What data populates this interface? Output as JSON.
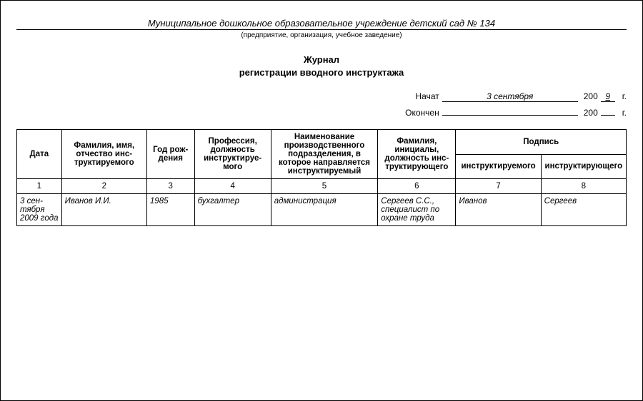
{
  "header": {
    "org_name": "Муниципальное дошкольное образовательное учреждение детский сад № 134",
    "org_sub": "(предприятие, организация, учебное заведение)",
    "title_line1": "Журнал",
    "title_line2": "регистрации вводного инструктажа"
  },
  "dates": {
    "start_label": "Начат",
    "start_value": "3 сентября",
    "century": "200",
    "start_year_digit": "9",
    "end_label": "Окончен",
    "end_value": "",
    "end_year_digit": "",
    "g": "г."
  },
  "columns": {
    "c1": "Дата",
    "c2": "Фамилия, имя, отчество инс­труктируемого",
    "c3": "Год рож­дения",
    "c4": "Профессия, должность инструктируе­мого",
    "c5": "Наименование производственного подразделения, в которое направляется инструктируемый",
    "c6": "Фамилия, инициалы, должность инс­труктирующего",
    "c7_group": "Подпись",
    "c7": "инструктируемого",
    "c8": "инструктирующего",
    "n1": "1",
    "n2": "2",
    "n3": "3",
    "n4": "4",
    "n5": "5",
    "n6": "6",
    "n7": "7",
    "n8": "8"
  },
  "rows": [
    {
      "date": "3 сен­тября 2009 года",
      "fio": "Иванов И.И.",
      "birth": "1985",
      "prof": "бухгалтер",
      "dept": "администрация",
      "instructor": "Сергеев С.С., специалист по охране труда",
      "sign_trainee": "Иванов",
      "sign_instructor": "Сергеев"
    }
  ]
}
